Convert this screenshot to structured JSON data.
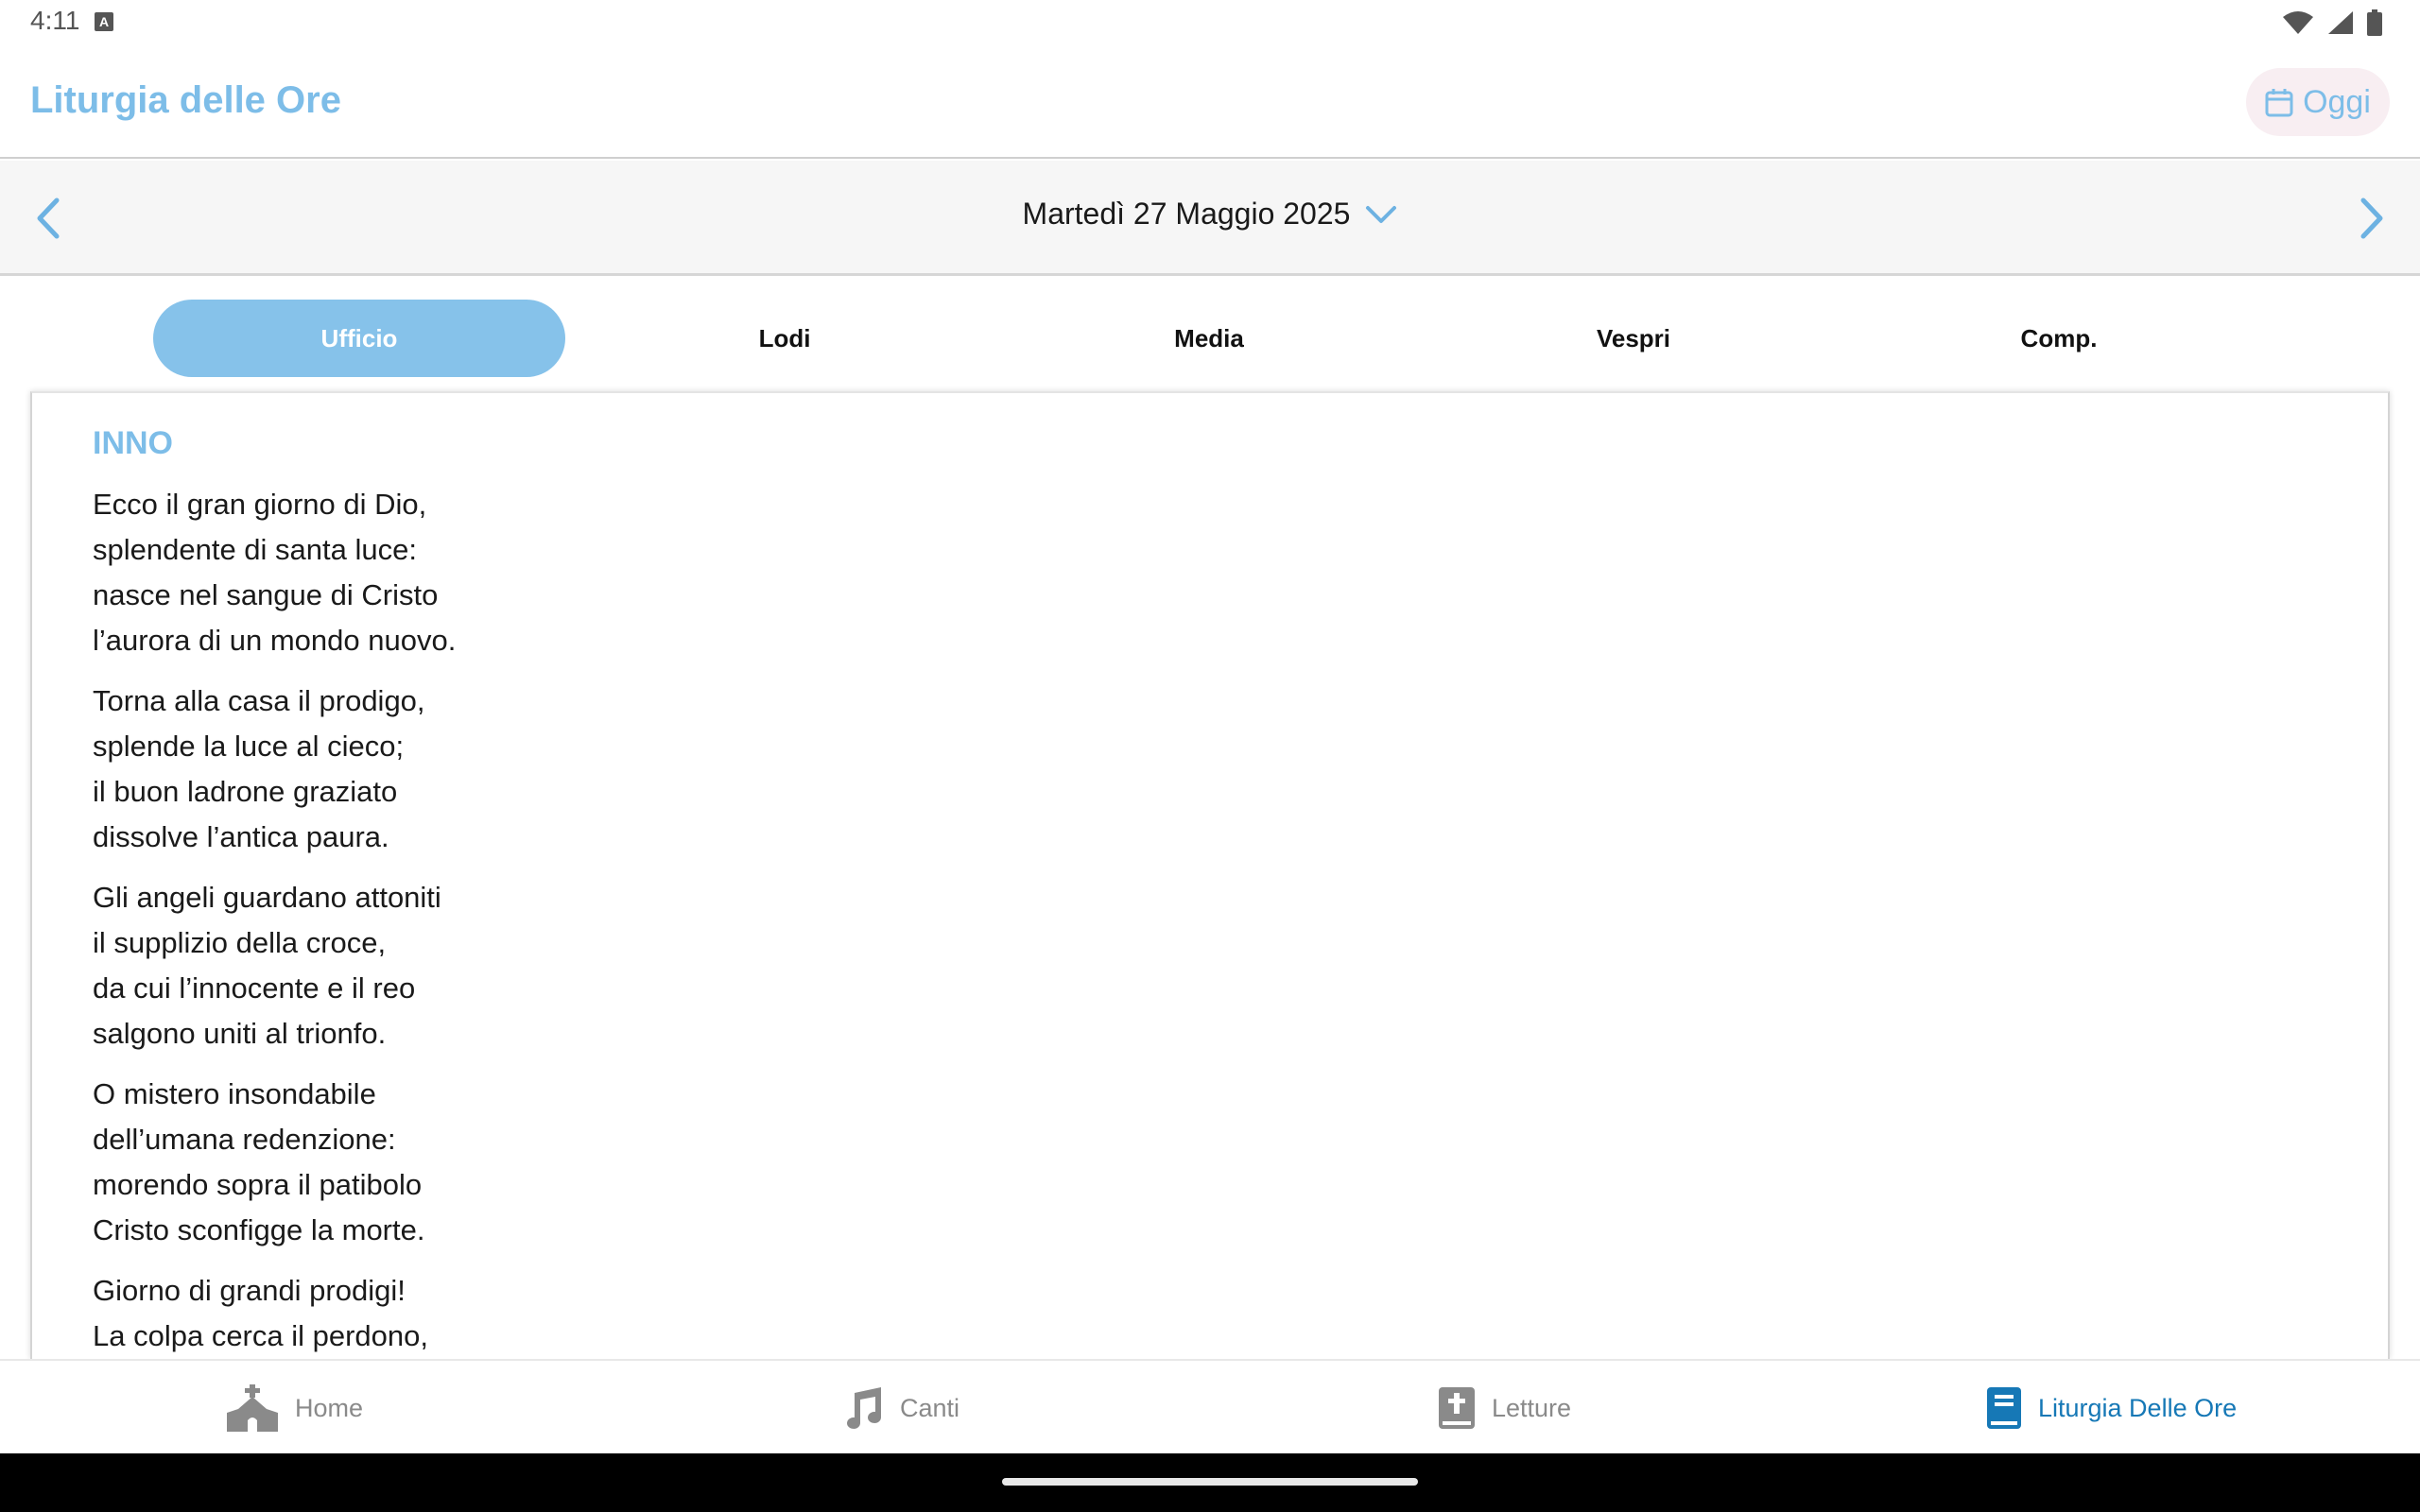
{
  "status_bar": {
    "time": "4:11",
    "notification_icon": "a-icon",
    "icons": [
      "wifi-icon",
      "signal-icon",
      "battery-icon"
    ]
  },
  "app_bar": {
    "title": "Liturgia delle Ore",
    "today_button": {
      "label": "Oggi",
      "icon": "calendar-icon"
    }
  },
  "date_bar": {
    "date": "Martedì 27 Maggio 2025",
    "prev_icon": "chevron-left-icon",
    "next_icon": "chevron-right-icon",
    "dropdown_icon": "chevron-down-icon"
  },
  "tabs": [
    {
      "label": "Ufficio",
      "active": true
    },
    {
      "label": "Lodi",
      "active": false
    },
    {
      "label": "Media",
      "active": false
    },
    {
      "label": "Vespri",
      "active": false
    },
    {
      "label": "Comp.",
      "active": false
    }
  ],
  "content": {
    "section_title": "INNO",
    "stanzas": [
      [
        "Ecco il gran giorno di Dio,",
        "splendente di santa luce:",
        "nasce nel sangue di Cristo",
        "l’aurora di un mondo nuovo."
      ],
      [
        "Torna alla casa il prodigo,",
        "splende la luce al cieco;",
        "il buon ladrone graziato",
        "dissolve l’antica paura."
      ],
      [
        "Gli angeli guardano attoniti",
        "il supplizio della croce,",
        "da cui l’innocente e il reo",
        "salgono uniti al trionfo."
      ],
      [
        "O mistero insondabile",
        "dell’umana redenzione:",
        "morendo sopra il patibolo",
        "Cristo sconfigge la morte."
      ],
      [
        "Giorno di grandi prodigi!",
        "La colpa cerca il perdono,"
      ]
    ]
  },
  "bottom_nav": [
    {
      "label": "Home",
      "icon": "church-icon",
      "active": false
    },
    {
      "label": "Canti",
      "icon": "music-note-icon",
      "active": false
    },
    {
      "label": "Letture",
      "icon": "bible-icon",
      "active": false
    },
    {
      "label": "Liturgia Delle Ore",
      "icon": "book-icon",
      "active": true
    }
  ],
  "colors": {
    "accent": "#7dbde8",
    "active_tab": "#86c2ea",
    "active_nav": "#1678b6",
    "inactive_nav": "#8a8a8a",
    "today_button_bg": "#f8eef2"
  }
}
